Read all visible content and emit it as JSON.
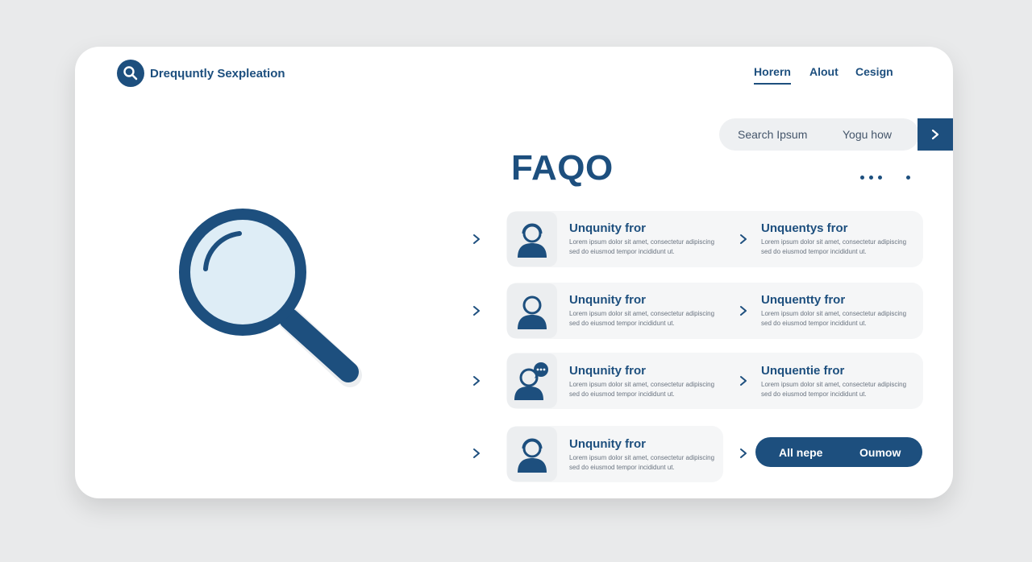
{
  "brand": {
    "name": "Dreqɥuntly Sexpleation"
  },
  "nav": {
    "home": "Horern",
    "about": "Alout",
    "design": "Cesign"
  },
  "search": {
    "placeholder": "Search Ipsum",
    "query": "Yogu how"
  },
  "page": {
    "title": "FAQO"
  },
  "faq_left": [
    {
      "title": "Unqunity fror",
      "body": "Lorem ipsum dolor sit amet, consectetur adipiscing sed do eiusmod tempor incididunt ut."
    },
    {
      "title": "Unqunity fror",
      "body": "Lorem ipsum dolor sit amet, consectetur adipiscing sed do eiusmod tempor incididunt ut."
    },
    {
      "title": "Unqunity fror",
      "body": "Lorem ipsum dolor sit amet, consectetur adipiscing sed do eiusmod tempor incididunt ut."
    },
    {
      "title": "Unqunity fror",
      "body": "Lorem ipsum dolor sit amet, consectetur adipiscing sed do eiusmod tempor incididunt ut."
    }
  ],
  "faq_right": [
    {
      "title": "Unquentys fror",
      "body": "Lorem ipsum dolor sit amet, consectetur adipiscing sed do eiusmod tempor incididunt ut."
    },
    {
      "title": "Unquentty fror",
      "body": "Lorem ipsum dolor sit amet, consectetur adipiscing sed do eiusmod tempor incididunt ut."
    },
    {
      "title": "Unquentie fror",
      "body": "Lorem ipsum dolor sit amet, consectetur adipiscing sed do eiusmod tempor incididunt ut."
    }
  ],
  "all_button": {
    "left": "All nepe",
    "right": "Oumow"
  },
  "icons": {
    "brand": "search-icon",
    "illustration": "magnifying-glass-icon",
    "submit": "chevron-right-icon",
    "avatar": "user-avatar-icon",
    "support": "chat-bubble-icon"
  },
  "colors": {
    "primary": "#1d4f7e",
    "panel": "#f5f6f7",
    "background": "#e9eaeb"
  }
}
